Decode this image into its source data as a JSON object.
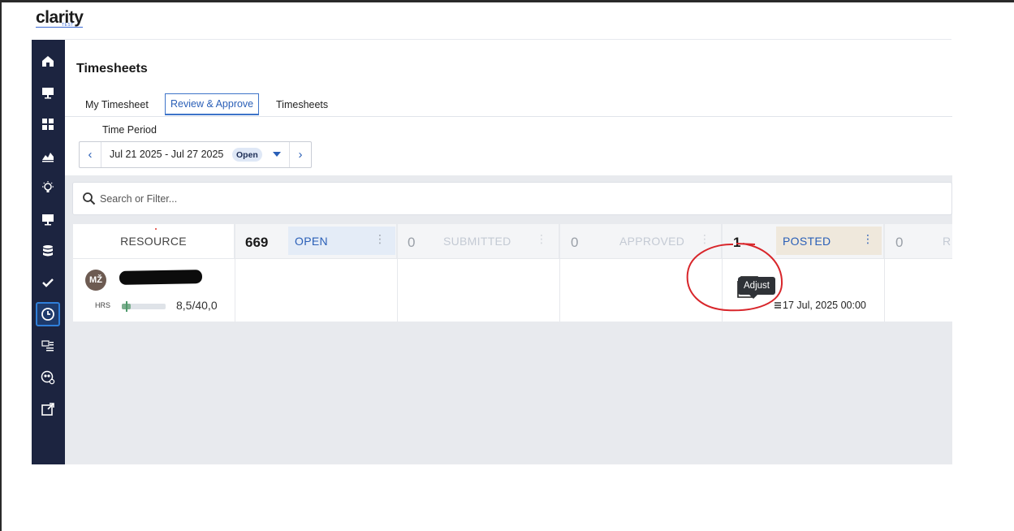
{
  "app": {
    "logo_text": "clarity",
    "logo_sub": "TEST"
  },
  "sidebar": {
    "items": [
      {
        "icon": "home-icon",
        "active": false
      },
      {
        "icon": "monitor-icon",
        "active": false
      },
      {
        "icon": "grid-icon",
        "active": false
      },
      {
        "icon": "area-chart-icon",
        "active": false
      },
      {
        "icon": "lightbulb-icon",
        "active": false
      },
      {
        "icon": "desktop-icon",
        "active": false
      },
      {
        "icon": "database-icon",
        "active": false
      },
      {
        "icon": "checkmark-icon",
        "active": false
      },
      {
        "icon": "clock-icon",
        "active": true
      },
      {
        "icon": "list-settings-icon",
        "active": false
      },
      {
        "icon": "team-settings-icon",
        "active": false
      },
      {
        "icon": "external-link-icon",
        "active": false
      }
    ]
  },
  "page": {
    "title": "Timesheets"
  },
  "tabs": [
    {
      "label": "My Timesheet",
      "active": false
    },
    {
      "label": "Review & Approve",
      "active": true
    },
    {
      "label": "Timesheets",
      "active": false
    }
  ],
  "time_period": {
    "label": "Time Period",
    "value": "Jul 21 2025 - Jul 27 2025",
    "status": "Open"
  },
  "search": {
    "placeholder": "Search or Filter..."
  },
  "board": {
    "resource_header": "RESOURCE",
    "columns": [
      {
        "count": "669",
        "label": "OPEN"
      },
      {
        "count": "0",
        "label": "SUBMITTED"
      },
      {
        "count": "0",
        "label": "APPROVED"
      },
      {
        "count": "1",
        "label": "POSTED"
      },
      {
        "count": "0",
        "label": "R"
      }
    ],
    "row": {
      "initials": "MŽ",
      "hrs_label": "HRS",
      "hrs_value": "8,5/40,0",
      "hrs_fraction": 0.2125
    },
    "posted_card": {
      "tooltip": "Adjust",
      "date": "17 Jul, 2025 00:00"
    }
  },
  "colors": {
    "sidebar_bg": "#1c2440",
    "accent_blue": "#2a5fb7",
    "open_pill": "#e4ecf7",
    "posted_pill": "#efe8dc",
    "annotation_red": "#d8262b"
  }
}
